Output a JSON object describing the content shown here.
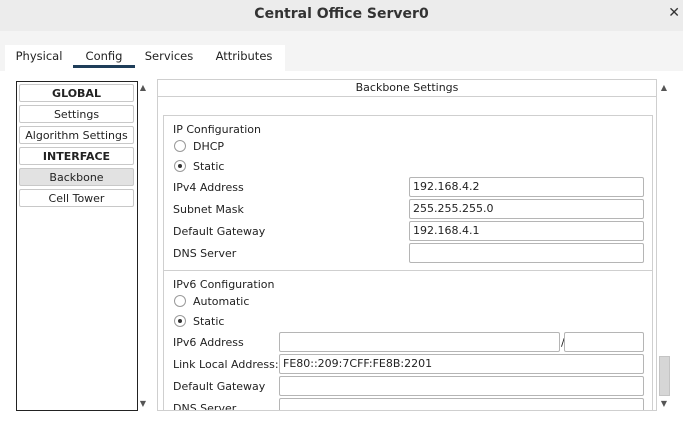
{
  "window": {
    "title": "Central Office Server0",
    "close_glyph": "✕"
  },
  "tabs": [
    {
      "label": "Physical",
      "active": false
    },
    {
      "label": "Config",
      "active": true
    },
    {
      "label": "Services",
      "active": false
    },
    {
      "label": "Attributes",
      "active": false
    }
  ],
  "sidebar": {
    "items": [
      {
        "label": "GLOBAL",
        "type": "header"
      },
      {
        "label": "Settings",
        "type": "item"
      },
      {
        "label": "Algorithm Settings",
        "type": "item"
      },
      {
        "label": "INTERFACE",
        "type": "header"
      },
      {
        "label": "Backbone",
        "type": "item",
        "selected": true
      },
      {
        "label": "Cell Tower",
        "type": "item"
      }
    ]
  },
  "panel": {
    "header": "Backbone Settings",
    "ipv4": {
      "title": "IP Configuration",
      "dhcp_label": "DHCP",
      "static_label": "Static",
      "selected_mode": "Static",
      "address_label": "IPv4 Address",
      "address_value": "192.168.4.2",
      "mask_label": "Subnet Mask",
      "mask_value": "255.255.255.0",
      "gateway_label": "Default Gateway",
      "gateway_value": "192.168.4.1",
      "dns_label": "DNS Server",
      "dns_value": ""
    },
    "ipv6": {
      "title": "IPv6 Configuration",
      "auto_label": "Automatic",
      "static_label": "Static",
      "selected_mode": "Static",
      "address_label": "IPv6 Address",
      "address_value": "",
      "separator": "/",
      "prefix_value": "",
      "link_local_label": "Link Local Address:",
      "link_local_value": "FE80::209:7CFF:FE8B:2201",
      "gateway_label": "Default Gateway",
      "gateway_value": "",
      "dns_label": "DNS Server",
      "dns_value": ""
    }
  },
  "icons": {
    "scroll_up": "▲",
    "scroll_down": "▼",
    "close": "close-icon"
  }
}
